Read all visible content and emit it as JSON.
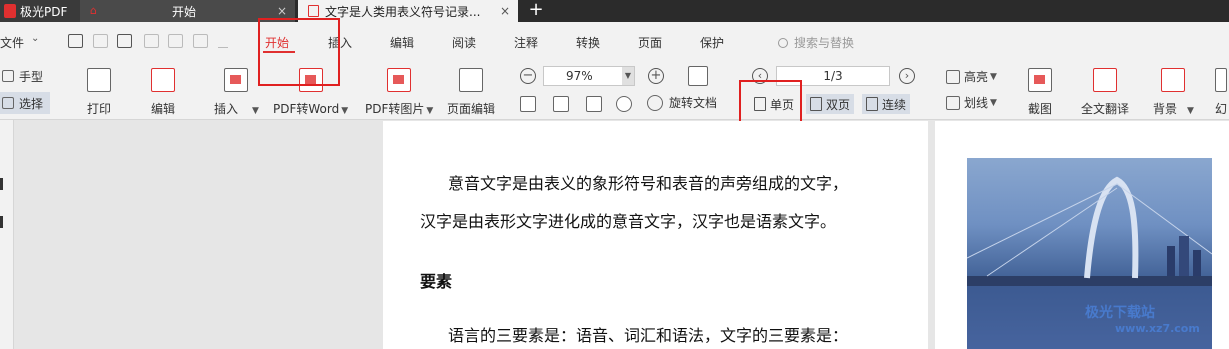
{
  "tabs": {
    "app": "极光PDF",
    "home": "开始",
    "document": "文字是人类用表义符号记录...",
    "add": "+",
    "close": "×"
  },
  "menu": {
    "file": "文件",
    "items": [
      "开始",
      "插入",
      "编辑",
      "阅读",
      "注释",
      "转换",
      "页面",
      "保护"
    ],
    "active": "开始",
    "search_placeholder": "搜索与替换"
  },
  "ribbon": {
    "hand": "手型",
    "select": "选择",
    "print": "打印",
    "edit": "编辑",
    "insert": "插入",
    "pdf_to_word": "PDF转Word",
    "pdf_to_image": "PDF转图片",
    "page_edit": "页面编辑",
    "zoom": "97%",
    "rotate_doc": "旋转文档",
    "page_indicator": "1/3",
    "single_page": "单页",
    "double_page": "双页",
    "continuous": "连续",
    "highlight": "高亮",
    "underline": "划线",
    "screenshot": "截图",
    "full_translate": "全文翻译",
    "background": "背景",
    "more": "幻"
  },
  "document": {
    "para1_line1": "意音文字是由表义的象形符号和表音的声旁组成的文字，",
    "para1_line2": "汉字是由表形文字进化成的意音文字，汉字也是语素文字。",
    "heading": "要素",
    "para2_line1": "语言的三要素是：语音、词汇和语法，文字的三要素是："
  },
  "watermark": {
    "text": "极光下载站",
    "url": "www.xz7.com"
  },
  "colors": {
    "accent": "#e03030",
    "annotation_box": "#e02020",
    "selected_bg": "#d7dde6"
  }
}
